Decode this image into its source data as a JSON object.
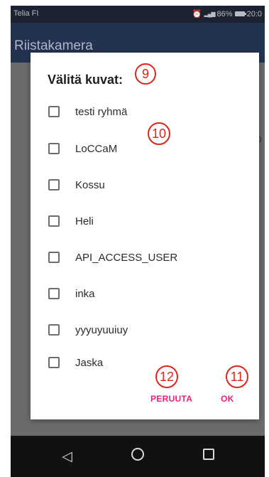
{
  "status_bar": {
    "carrier": "Telia FI",
    "battery": "86%",
    "time": "20:0"
  },
  "app_bar": {
    "title": "Riistakamera"
  },
  "content": {
    "hint": "o"
  },
  "dialog": {
    "title": "Välitä kuvat:",
    "options": [
      {
        "label": "testi ryhmä",
        "checked": false
      },
      {
        "label": "LoCCaM",
        "checked": false
      },
      {
        "label": "Kossu",
        "checked": false
      },
      {
        "label": "Heli",
        "checked": false
      },
      {
        "label": "API_ACCESS_USER",
        "checked": false
      },
      {
        "label": "inka",
        "checked": false
      },
      {
        "label": "yyyuyuuiuy",
        "checked": false
      },
      {
        "label": "Jaska",
        "checked": false
      }
    ],
    "cancel_label": "PERUUTA",
    "ok_label": "OK"
  },
  "annotations": {
    "m9": "9",
    "m10": "10",
    "m11": "11",
    "m12": "12"
  },
  "colors": {
    "accent": "#ec1f79",
    "app_bar": "#243252",
    "marker": "#e2231a"
  },
  "nav_icons": [
    "back-icon",
    "home-icon",
    "recents-icon"
  ]
}
